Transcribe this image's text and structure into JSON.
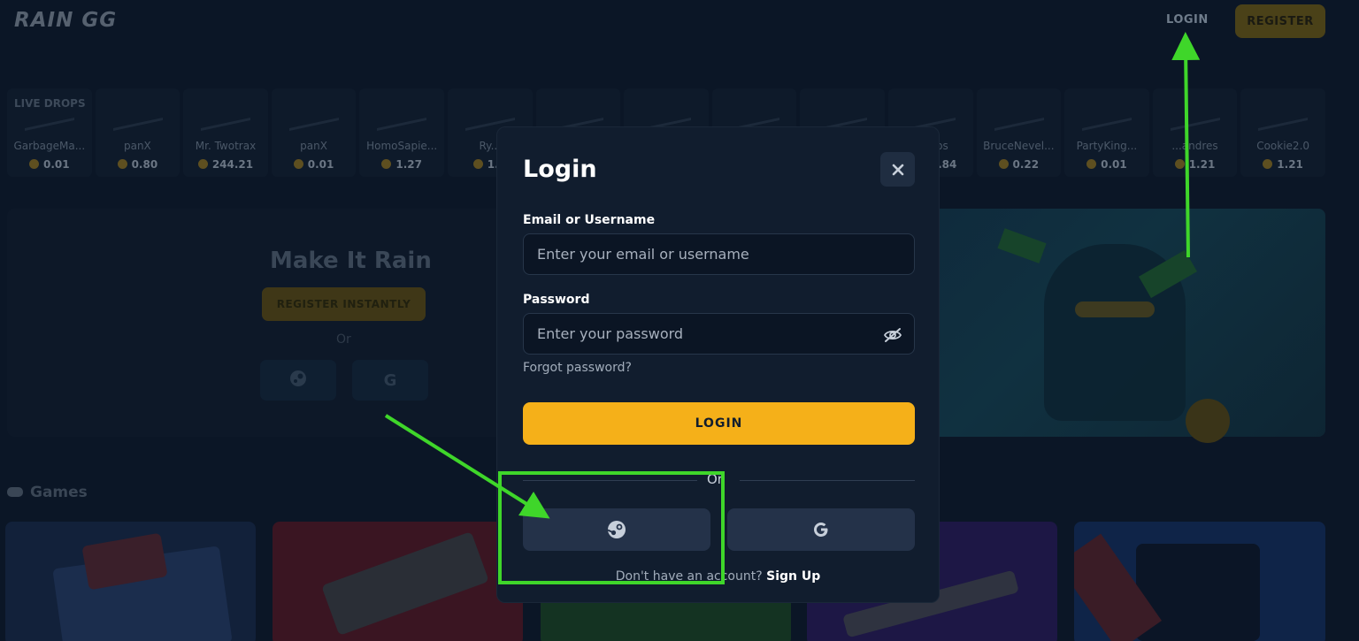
{
  "header": {
    "logo": "RAIN GG",
    "login_label": "LOGIN",
    "register_label": "REGISTER"
  },
  "live_drops": {
    "label": "LIVE DROPS",
    "items": [
      {
        "user": "GarbageMa...",
        "value": "0.01"
      },
      {
        "user": "panX",
        "value": "0.80"
      },
      {
        "user": "Mr. Twotrax",
        "value": "244.21"
      },
      {
        "user": "panX",
        "value": "0.01"
      },
      {
        "user": "HomoSapie...",
        "value": "1.27"
      },
      {
        "user": "Ry...",
        "value": "1..."
      },
      {
        "user": "",
        "value": ""
      },
      {
        "user": "",
        "value": ""
      },
      {
        "user": "",
        "value": ""
      },
      {
        "user": "",
        "value": ""
      },
      {
        "user": "...oobs",
        "value": "...9.84"
      },
      {
        "user": "BruceNevel...",
        "value": "0.22"
      },
      {
        "user": "PartyKing...",
        "value": "0.01"
      },
      {
        "user": "...andres",
        "value": "1.21"
      },
      {
        "user": "Cookie2.0",
        "value": "1.21"
      }
    ]
  },
  "hero": {
    "title": "Make It Rain",
    "register_label": "REGISTER INSTANTLY",
    "or_label": "Or",
    "steam_icon": "steam-icon",
    "google_icon": "google-icon",
    "google_glyph": "G"
  },
  "games": {
    "title": "Games",
    "icon": "gamepad-icon"
  },
  "modal": {
    "title": "Login",
    "close_icon": "close-icon",
    "email_label": "Email or Username",
    "email_placeholder": "Enter your email or username",
    "email_value": "",
    "password_label": "Password",
    "password_placeholder": "Enter your password",
    "password_value": "",
    "eye_icon": "eye-off-icon",
    "forgot_label": "Forgot password?",
    "login_button": "LOGIN",
    "divider_text": "Or",
    "steam_icon": "steam-icon",
    "google_icon": "google-icon",
    "signup_prompt": "Don't have an account?",
    "signup_link": "Sign Up"
  },
  "colors": {
    "background": "#0b1626",
    "modal": "#111d2e",
    "accent": "#f5b019",
    "annotation": "#3fd62a"
  }
}
